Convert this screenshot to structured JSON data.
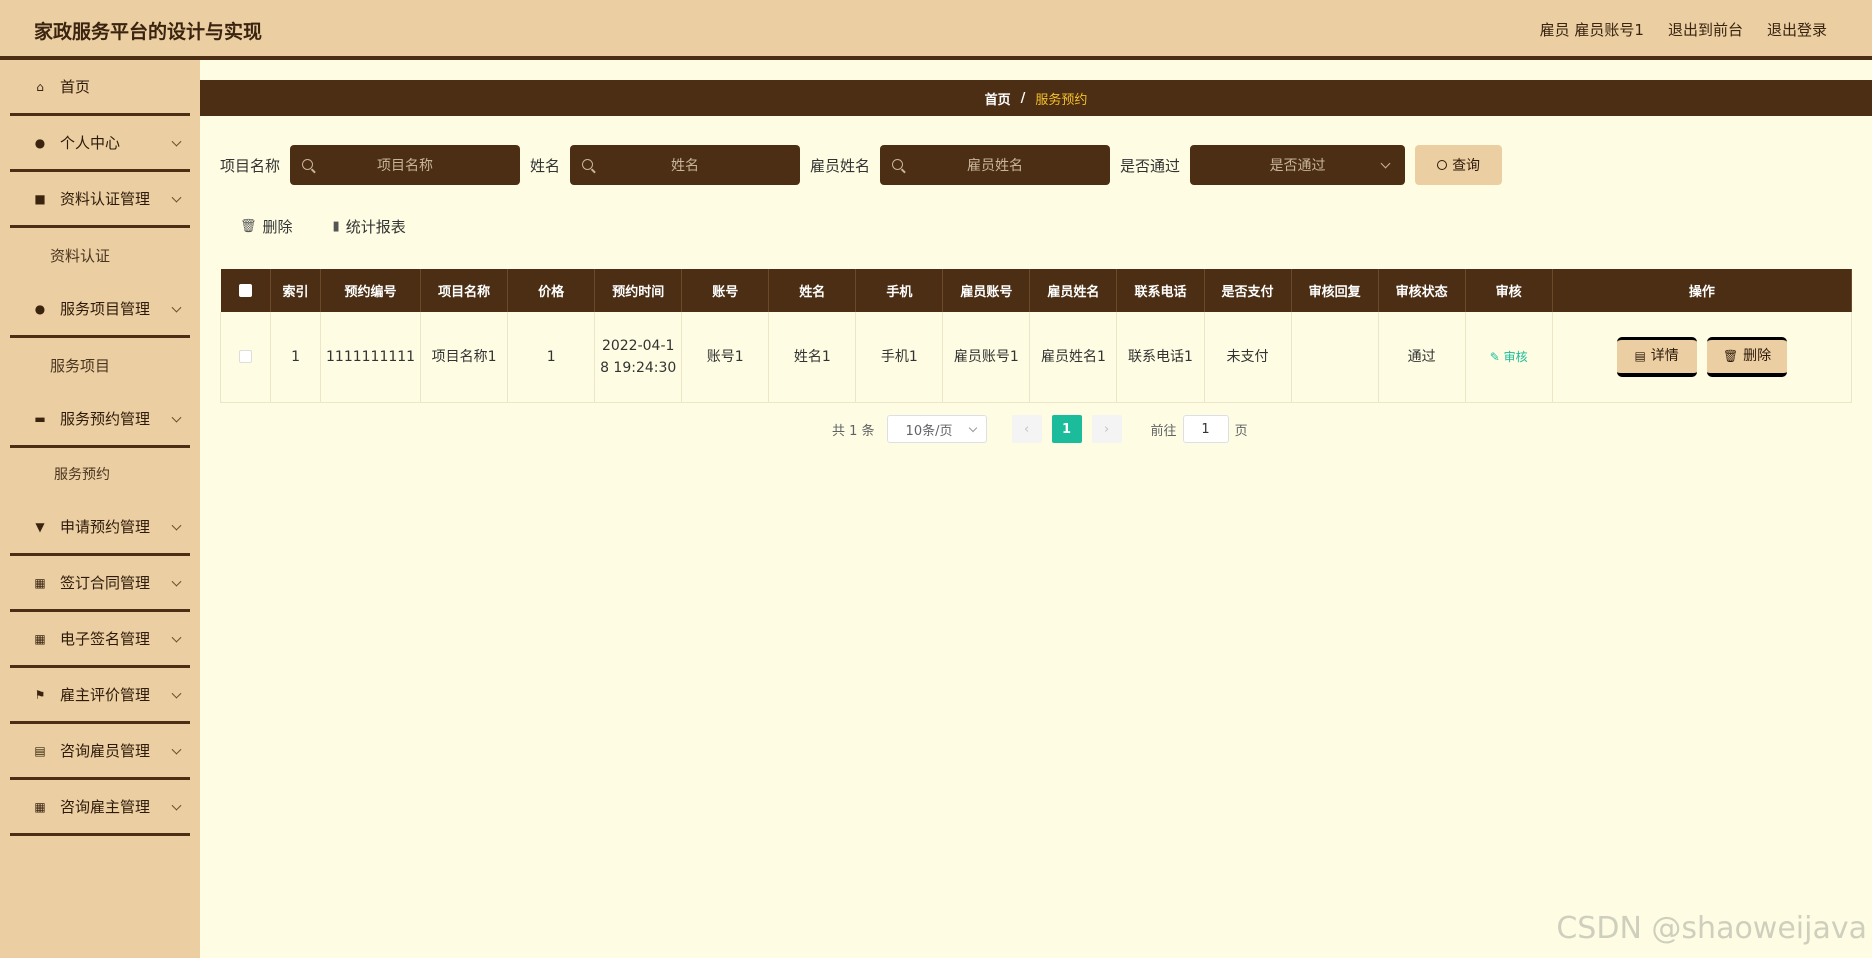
{
  "header": {
    "title": "家政服务平台的设计与实现",
    "user": "雇员 雇员账号1",
    "to_front": "退出到前台",
    "logout": "退出登录"
  },
  "sidebar": {
    "items": [
      {
        "label": "首页",
        "icon": "home-icon"
      },
      {
        "label": "个人中心",
        "icon": "user-icon"
      },
      {
        "label": "资料认证管理",
        "icon": "briefcase-icon",
        "sub": "资料认证"
      },
      {
        "label": "服务项目管理",
        "icon": "user-icon",
        "sub": "服务项目"
      },
      {
        "label": "服务预约管理",
        "icon": "tag-icon",
        "sub": "服务预约"
      },
      {
        "label": "申请预约管理",
        "icon": "flag-icon"
      },
      {
        "label": "签订合同管理",
        "icon": "grid-icon"
      },
      {
        "label": "电子签名管理",
        "icon": "grid-icon"
      },
      {
        "label": "雇主评价管理",
        "icon": "flag-icon"
      },
      {
        "label": "咨询雇员管理",
        "icon": "chart-icon"
      },
      {
        "label": "咨询雇主管理",
        "icon": "grid-icon"
      }
    ]
  },
  "breadcrumb": {
    "home": "首页",
    "sep": "/",
    "current": "服务预约"
  },
  "search": {
    "project_label": "项目名称",
    "project_placeholder": "项目名称",
    "name_label": "姓名",
    "name_placeholder": "姓名",
    "employee_label": "雇员姓名",
    "employee_placeholder": "雇员姓名",
    "passed_label": "是否通过",
    "passed_placeholder": "是否通过",
    "query_button": "查询"
  },
  "actions": {
    "delete": "删除",
    "report": "统计报表"
  },
  "table": {
    "headers": [
      "索引",
      "预约编号",
      "项目名称",
      "价格",
      "预约时间",
      "账号",
      "姓名",
      "手机",
      "雇员账号",
      "雇员姓名",
      "联系电话",
      "是否支付",
      "审核回复",
      "审核状态",
      "审核",
      "操作"
    ],
    "rows": [
      {
        "index": "1",
        "booking_no": "1111111111",
        "project": "项目名称1",
        "price": "1",
        "time": "2022-04-18 19:24:30",
        "account": "账号1",
        "name": "姓名1",
        "phone": "手机1",
        "emp_account": "雇员账号1",
        "emp_name": "雇员姓名1",
        "contact": "联系电话1",
        "paid": "未支付",
        "reply": "",
        "status": "通过",
        "audit": "审核",
        "detail_btn": "详情",
        "delete_btn": "删除"
      }
    ]
  },
  "pagination": {
    "total": "共 1 条",
    "page_size": "10条/页",
    "current": "1",
    "goto_label": "前往",
    "goto_value": "1",
    "page_unit": "页"
  },
  "watermark": "CSDN @shaoweijava"
}
